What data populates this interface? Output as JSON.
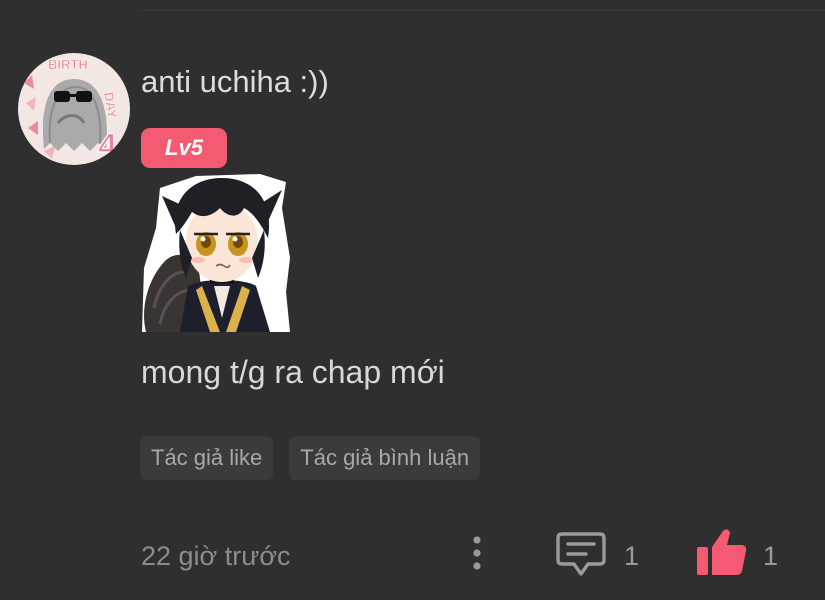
{
  "comment": {
    "username": "anti uchiha :))",
    "level_badge": "Lv5",
    "text": "mong t/g ra chap mới",
    "tags": [
      "Tác giả like",
      "Tác giả bình luận"
    ],
    "timestamp": "22 giờ trước",
    "reply_count": "1",
    "like_count": "1"
  },
  "avatar": {
    "decor_text": "BIRTHDAY",
    "decor_number": "4"
  },
  "icons": {
    "more": "more-vertical-icon",
    "reply": "comment-icon",
    "like": "thumbs-up-icon"
  },
  "colors": {
    "background": "#2f2f2f",
    "badge": "#f45b72",
    "like": "#f45b72",
    "tag_bg": "#3b3b3b"
  }
}
